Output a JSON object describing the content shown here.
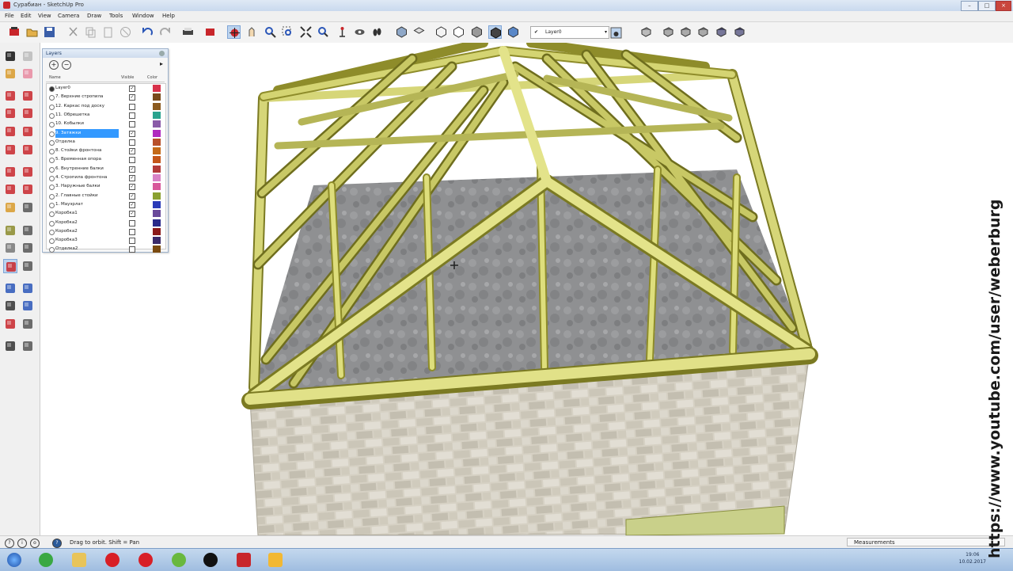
{
  "window": {
    "title": "Сурабиан - SketchUp Pro"
  },
  "menu": [
    "File",
    "Edit",
    "View",
    "Camera",
    "Draw",
    "Tools",
    "Window",
    "Help"
  ],
  "toolbar": {
    "layer_current": "Layer0"
  },
  "layers_panel": {
    "title": "Layers",
    "columns": {
      "name": "Name",
      "visible": "Visible",
      "color": "Color"
    },
    "rows": [
      {
        "name": "Layer0",
        "visible": true,
        "color": "#d8314a",
        "active": true,
        "selected": false
      },
      {
        "name": "7. Верхние стропила",
        "visible": true,
        "color": "#7a4a1b",
        "active": false,
        "selected": false
      },
      {
        "name": "12. Каркас под доску",
        "visible": false,
        "color": "#8b5a1e",
        "active": false,
        "selected": false
      },
      {
        "name": "11. Обрешетка",
        "visible": false,
        "color": "#2aa38e",
        "active": false,
        "selected": false
      },
      {
        "name": "10. Кобылки",
        "visible": false,
        "color": "#8a5aa8",
        "active": false,
        "selected": false
      },
      {
        "name": "9. Затяжки",
        "visible": true,
        "color": "#b02abf",
        "active": false,
        "selected": true
      },
      {
        "name": "Отделка",
        "visible": false,
        "color": "#b8502a",
        "active": false,
        "selected": false
      },
      {
        "name": "8. Стойки фронтона",
        "visible": true,
        "color": "#c46a18",
        "active": false,
        "selected": false
      },
      {
        "name": "5. Временная опора",
        "visible": false,
        "color": "#c4561a",
        "active": false,
        "selected": false
      },
      {
        "name": "6. Внутренние балки",
        "visible": true,
        "color": "#b23a3a",
        "active": false,
        "selected": false
      },
      {
        "name": "4. Стропила фронтона",
        "visible": true,
        "color": "#d882c6",
        "active": false,
        "selected": false
      },
      {
        "name": "3. Наружные балки",
        "visible": true,
        "color": "#d8589a",
        "active": false,
        "selected": false
      },
      {
        "name": "2. Главные стойки",
        "visible": true,
        "color": "#8aa030",
        "active": false,
        "selected": false
      },
      {
        "name": "1. Мауэрлат",
        "visible": true,
        "color": "#2a3ab8",
        "active": false,
        "selected": false
      },
      {
        "name": "Коробка1",
        "visible": true,
        "color": "#6a4a9a",
        "active": false,
        "selected": false
      },
      {
        "name": "Коробка2",
        "visible": false,
        "color": "#2a2a8a",
        "active": false,
        "selected": false
      },
      {
        "name": "Коробка2",
        "visible": false,
        "color": "#8a1a1a",
        "active": false,
        "selected": false
      },
      {
        "name": "Коробка3",
        "visible": false,
        "color": "#3a2a6a",
        "active": false,
        "selected": false
      },
      {
        "name": "Отделка2",
        "visible": false,
        "color": "#7a4a10",
        "active": false,
        "selected": false
      }
    ]
  },
  "status": {
    "hint": "Drag to orbit.  Shift = Pan",
    "measurements_label": "Measurements"
  },
  "taskbar": {
    "time": "19:06",
    "date": "10.02.2017"
  },
  "watermark": "https://www.youtube.com/user/weberburg",
  "colors": {
    "wood": "#d8d86e",
    "wood_dark": "#8e8c2a",
    "floor": "#8f9090",
    "brick": "#d9d4c8"
  }
}
